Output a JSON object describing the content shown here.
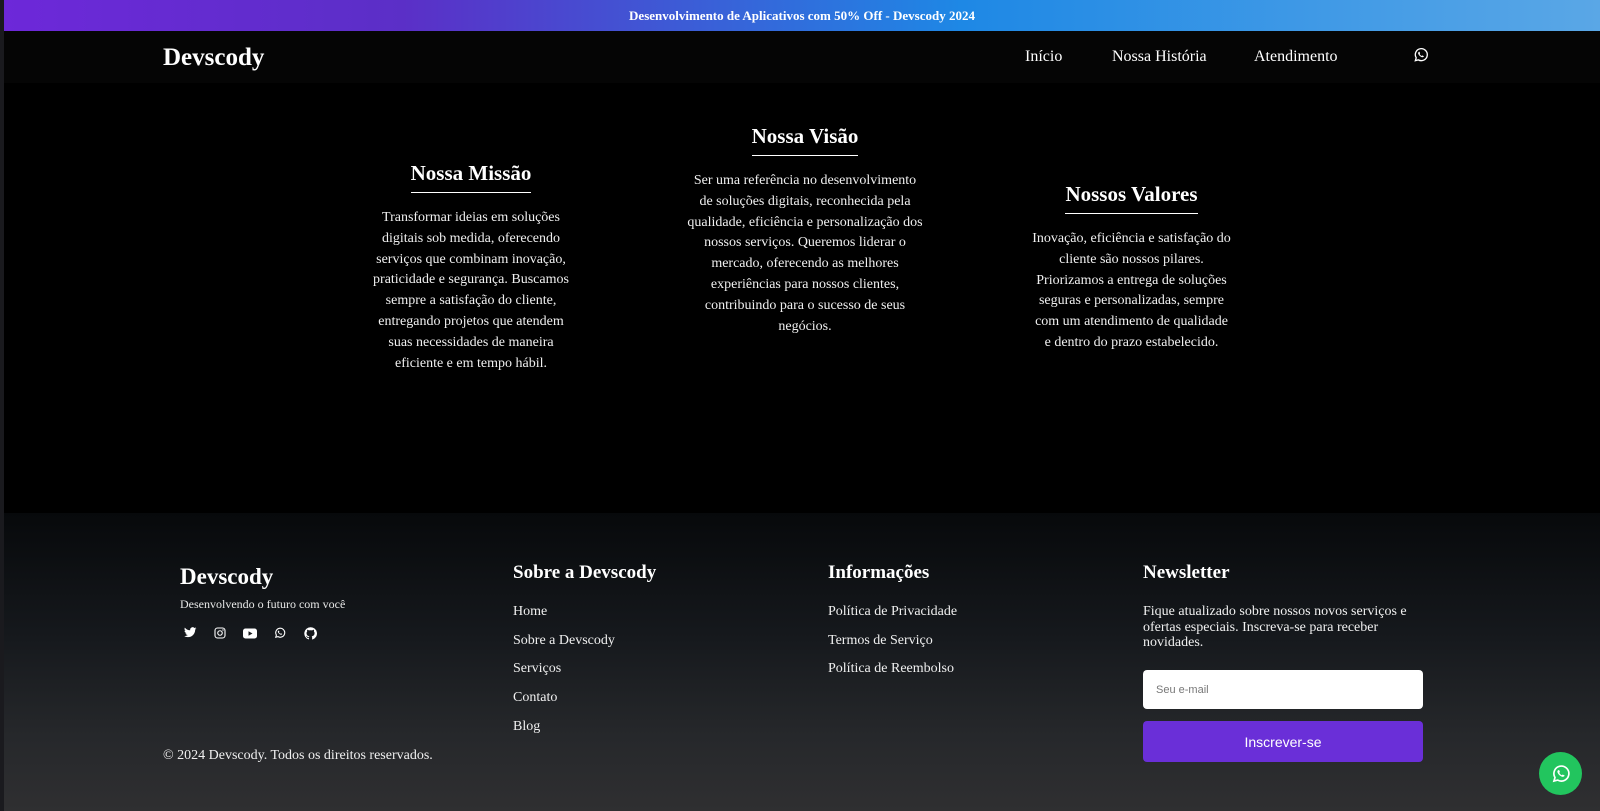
{
  "announcement": "Desenvolvimento de Aplicativos com 50% Off - Devscody 2024",
  "nav": {
    "brand": "Devscody",
    "links": [
      "Início",
      "Nossa História",
      "Atendimento"
    ],
    "whatsapp_icon": "whatsapp-icon"
  },
  "cards": [
    {
      "title": "Nossa Missão",
      "text": "Transformar ideias em soluções digitais sob medida, oferecendo serviços que combinam inovação, praticidade e segurança. Buscamos sempre a satisfação do cliente, entregando projetos que atendem suas necessidades de maneira eficiente e em tempo hábil."
    },
    {
      "title": "Nossa Visão",
      "text": "Ser uma referência no desenvolvimento de soluções digitais, reconhecida pela qualidade, eficiência e personalização dos nossos serviços. Queremos liderar o mercado, oferecendo as melhores experiências para nossos clientes, contribuindo para o sucesso de seus negócios."
    },
    {
      "title": "Nossos Valores",
      "text": "Inovação, eficiência e satisfação do cliente são nossos pilares. Priorizamos a entrega de soluções seguras e personalizadas, sempre com um atendimento de qualidade e dentro do prazo estabelecido."
    }
  ],
  "footer": {
    "brand": "Devscody",
    "tagline": "Desenvolvendo o futuro com você",
    "socials": [
      "twitter-icon",
      "instagram-icon",
      "youtube-icon",
      "whatsapp-icon",
      "github-icon"
    ],
    "about": {
      "title": "Sobre a Devscody",
      "links": [
        "Home",
        "Sobre a Devscody",
        "Serviços",
        "Contato",
        "Blog"
      ]
    },
    "info": {
      "title": "Informações",
      "links": [
        "Política de Privacidade",
        "Termos de Serviço",
        "Política de Reembolso"
      ]
    },
    "newsletter": {
      "title": "Newsletter",
      "text": "Fique atualizado sobre nossos novos serviços e ofertas especiais. Inscreva-se para receber novidades.",
      "placeholder": "Seu e-mail",
      "button": "Inscrever-se"
    },
    "copyright": "© 2024 Devscody. Todos os direitos reservados."
  },
  "colors": {
    "accent": "#6a2fd8",
    "whatsapp": "#22c55e",
    "topbar_start": "#6d28d9",
    "topbar_end": "#5aa7e6"
  }
}
